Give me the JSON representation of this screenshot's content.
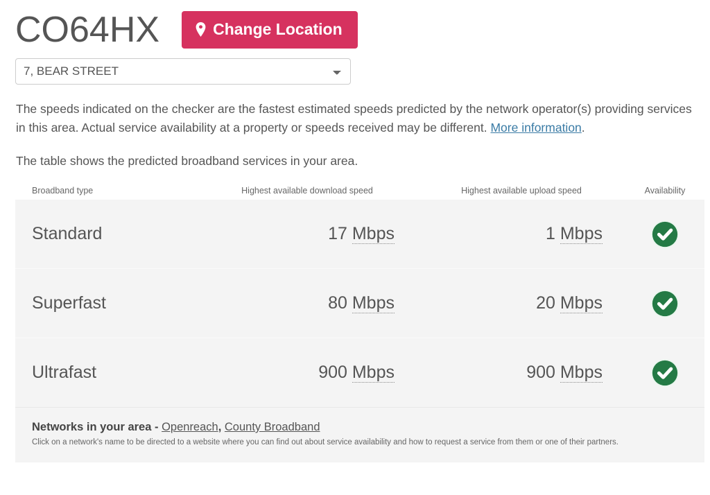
{
  "header": {
    "postcode": "CO64HX",
    "change_location_label": "Change Location",
    "pin_icon": "map-pin-icon",
    "button_color": "#d6325f"
  },
  "address_select": {
    "selected": "7, BEAR STREET",
    "options": [
      "7, BEAR STREET"
    ]
  },
  "intro": {
    "paragraph1_part1": "The speeds indicated on the checker are the fastest estimated speeds predicted by the network operator(s) providing services in this area. Actual service availability at a property or speeds received may be different. ",
    "more_information_label": "More information",
    "paragraph1_part2": ".",
    "paragraph2": "The table shows the predicted broadband services in your area.",
    "link_color": "#3a7ba5"
  },
  "table": {
    "headers": {
      "type": "Broadband type",
      "download": "Highest available download speed",
      "upload": "Highest available upload speed",
      "availability": "Availability"
    },
    "unit": "Mbps",
    "available_icon": "check-circle-icon",
    "available_icon_color": "#247a45",
    "rows": [
      {
        "type": "Standard",
        "download_value": "17",
        "download_unit": "Mbps",
        "upload_value": "1",
        "upload_unit": "Mbps",
        "available": true
      },
      {
        "type": "Superfast",
        "download_value": "80",
        "download_unit": "Mbps",
        "upload_value": "20",
        "upload_unit": "Mbps",
        "available": true
      },
      {
        "type": "Ultrafast",
        "download_value": "900",
        "download_unit": "Mbps",
        "upload_value": "900",
        "upload_unit": "Mbps",
        "available": true
      }
    ]
  },
  "footer": {
    "title": "Networks in your area",
    "separator": " - ",
    "networks": [
      "Openreach",
      "County Broadband"
    ],
    "network_join": ", ",
    "note": "Click on a network's name to be directed to a website where you can find out about service availability and how to request a service from them or one of their partners."
  }
}
